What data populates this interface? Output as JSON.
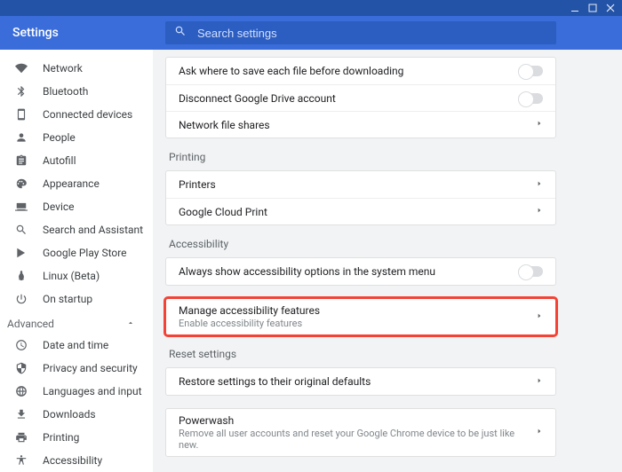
{
  "window": {
    "title": "Settings"
  },
  "search": {
    "placeholder": "Search settings"
  },
  "sidebar": {
    "main": [
      {
        "label": "Network",
        "icon": "wifi"
      },
      {
        "label": "Bluetooth",
        "icon": "bluetooth"
      },
      {
        "label": "Connected devices",
        "icon": "phone"
      },
      {
        "label": "People",
        "icon": "person"
      },
      {
        "label": "Autofill",
        "icon": "assignment"
      },
      {
        "label": "Appearance",
        "icon": "palette"
      },
      {
        "label": "Device",
        "icon": "laptop"
      },
      {
        "label": "Search and Assistant",
        "icon": "search"
      },
      {
        "label": "Google Play Store",
        "icon": "play"
      },
      {
        "label": "Linux (Beta)",
        "icon": "linux"
      },
      {
        "label": "On startup",
        "icon": "power"
      }
    ],
    "advanced_label": "Advanced",
    "advanced": [
      {
        "label": "Date and time",
        "icon": "clock"
      },
      {
        "label": "Privacy and security",
        "icon": "shield"
      },
      {
        "label": "Languages and input",
        "icon": "globe"
      },
      {
        "label": "Downloads",
        "icon": "download"
      },
      {
        "label": "Printing",
        "icon": "printer"
      },
      {
        "label": "Accessibility",
        "icon": "accessibility"
      }
    ]
  },
  "content": {
    "downloads_rows": [
      {
        "title": "Ask where to save each file before downloading",
        "control": "toggle"
      },
      {
        "title": "Disconnect Google Drive account",
        "control": "toggle"
      },
      {
        "title": "Network file shares",
        "control": "arrow"
      }
    ],
    "printing_header": "Printing",
    "printing_rows": [
      {
        "title": "Printers",
        "control": "arrow"
      },
      {
        "title": "Google Cloud Print",
        "control": "arrow"
      }
    ],
    "accessibility_header": "Accessibility",
    "accessibility_rows": [
      {
        "title": "Always show accessibility options in the system menu",
        "control": "toggle"
      },
      {
        "title": "Manage accessibility features",
        "subtitle": "Enable accessibility features",
        "control": "arrow",
        "highlight": true
      }
    ],
    "reset_header": "Reset settings",
    "reset_rows": [
      {
        "title": "Restore settings to their original defaults",
        "control": "arrow"
      },
      {
        "title": "Powerwash",
        "subtitle": "Remove all user accounts and reset your Google Chrome device to be just like new.",
        "control": "arrow"
      }
    ]
  }
}
